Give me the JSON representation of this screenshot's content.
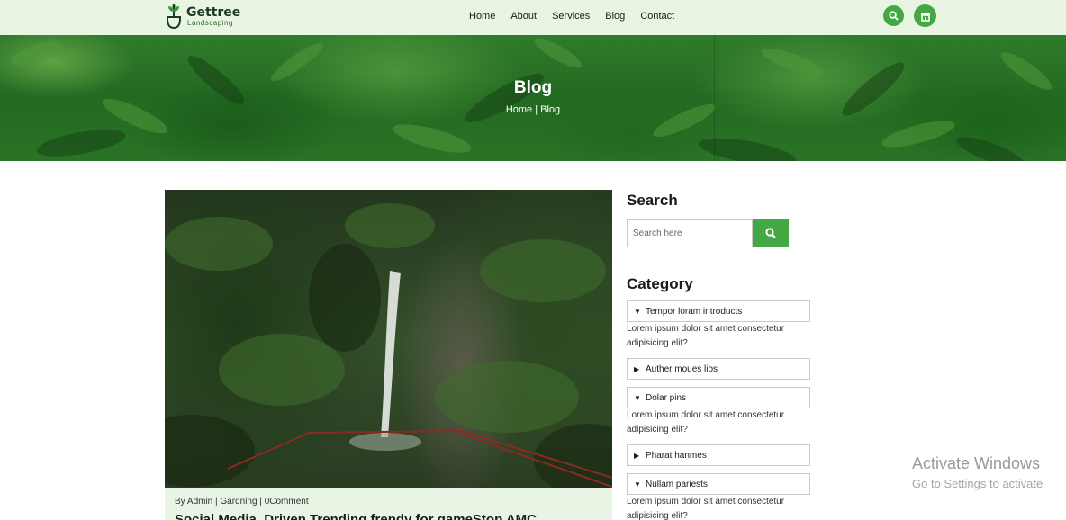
{
  "brand": {
    "name": "Gettree",
    "tagline": "Landscaping"
  },
  "nav": [
    "Home",
    "About",
    "Services",
    "Blog",
    "Contact"
  ],
  "header_icons": [
    "search-icon",
    "store-icon"
  ],
  "hero": {
    "title": "Blog",
    "breadcrumb": "Home | Blog"
  },
  "post": {
    "meta": "By Admin | Gardning | 0Comment",
    "title": "Social Media, Driven Trending frendy for gameStop AMC"
  },
  "sidebar": {
    "search_heading": "Search",
    "search_placeholder": "Search here",
    "category_heading": "Category",
    "categories": [
      {
        "label": "Tempor loram introducts",
        "expanded": true,
        "body": "Lorem ipsum dolor sit amet consectetur adipisicing elit?"
      },
      {
        "label": "Auther moues lios",
        "expanded": false,
        "body": ""
      },
      {
        "label": "Dolar pins",
        "expanded": true,
        "body": "Lorem ipsum dolor sit amet consectetur adipisicing elit?"
      },
      {
        "label": "Pharat hanmes",
        "expanded": false,
        "body": ""
      },
      {
        "label": "Nullam pariests",
        "expanded": true,
        "body": "Lorem ipsum dolor sit amet consectetur adipisicing elit?"
      }
    ]
  },
  "watermark": {
    "line1": "Activate Windows",
    "line2": "Go to Settings to activate"
  },
  "colors": {
    "accent": "#43a843",
    "header_bg": "#e8f5e2",
    "meta_bg": "#e9f5e4"
  },
  "arrows": {
    "expanded": "▼",
    "collapsed": "▶"
  }
}
